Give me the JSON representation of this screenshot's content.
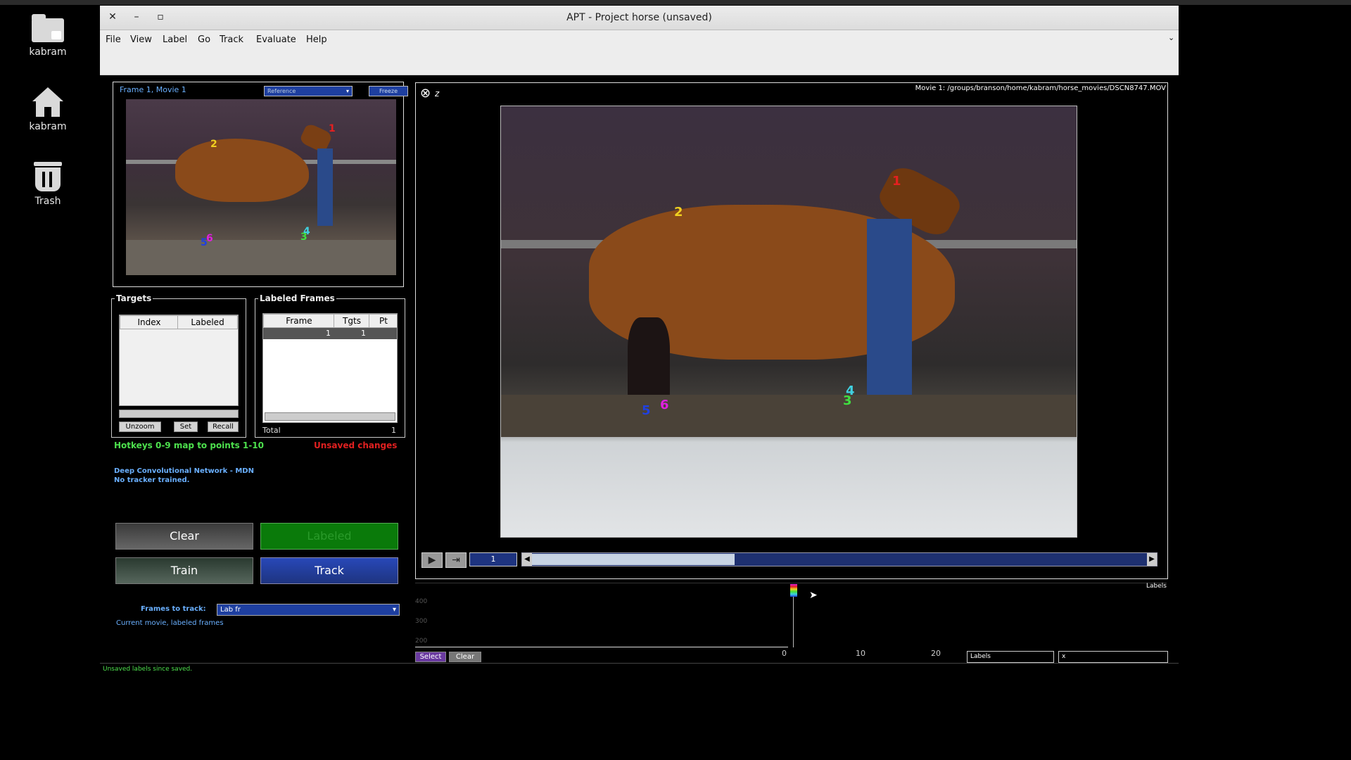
{
  "desktop": {
    "icons": [
      {
        "label": "kabram",
        "icon": "folder-icon"
      },
      {
        "label": "kabram",
        "icon": "home-icon"
      },
      {
        "label": "Trash",
        "icon": "trash-icon"
      }
    ]
  },
  "window": {
    "title": "APT - Project horse (unsaved)",
    "controls": {
      "close": "✕",
      "minimize": "–",
      "maximize": "▫"
    },
    "menu": [
      "File",
      "View",
      "Label",
      "Go",
      "Track",
      "Evaluate",
      "Help"
    ],
    "menu_overflow": "⌄"
  },
  "reference_panel": {
    "frame_label": "Frame 1, Movie 1",
    "dropdown_value": "Reference",
    "freeze_button": "Freeze",
    "points": [
      {
        "id": "1",
        "color": "#e52020"
      },
      {
        "id": "2",
        "color": "#f0d020"
      },
      {
        "id": "3",
        "color": "#40e040"
      },
      {
        "id": "4",
        "color": "#40d0e0"
      },
      {
        "id": "5",
        "color": "#2040e0"
      },
      {
        "id": "6",
        "color": "#e020e0"
      }
    ]
  },
  "targets": {
    "title": "Targets",
    "columns": [
      "Index",
      "Labeled"
    ],
    "buttons": {
      "unzoom": "Unzoom",
      "set": "Set",
      "recall": "Recall"
    }
  },
  "labeled_frames": {
    "title": "Labeled Frames",
    "columns": [
      "Frame",
      "Tgts",
      "Pt"
    ],
    "rows": [
      {
        "frame": "1",
        "tgts": "1",
        "pt": ""
      }
    ],
    "total_label": "Total",
    "total_value": "1"
  },
  "status": {
    "hotkeys": "Hotkeys 0-9 map to points 1-10",
    "unsaved": "Unsaved changes",
    "tracker_name": "Deep Convolutional Network - MDN",
    "tracker_state": "No tracker trained."
  },
  "actions": {
    "clear": "Clear",
    "labeled": "Labeled",
    "train": "Train",
    "track": "Track"
  },
  "frames_to_track": {
    "label": "Frames to track:",
    "value": "Lab fr",
    "description": "Current movie, labeled frames"
  },
  "main_view": {
    "movie_path": "Movie 1: /groups/branson/home/kabram/horse_movies/DSCN8747.MOV",
    "zoom_icon_glyph": "⊗",
    "zoom_sub_glyph": "z"
  },
  "playback": {
    "frame_value": "1",
    "play_icon": "▶",
    "next_icon": "⇥",
    "slider_fraction": 0.33
  },
  "timeline": {
    "legend_label": "Labels",
    "y_ticks": [
      "400",
      "300",
      "200"
    ],
    "x_ticks": [
      "0",
      "10",
      "20"
    ],
    "select_button": "Select",
    "clear_button": "Clear",
    "dropdown_labels": "Labels",
    "dropdown_x": "x"
  },
  "footer": {
    "message": "Unsaved labels since  saved."
  },
  "colors": {
    "green_text": "#4de04d",
    "blue_text": "#6ab0ff",
    "red_text": "#e02020",
    "labeled_green": "#0a7a0a",
    "track_blue": "#2848b8"
  }
}
